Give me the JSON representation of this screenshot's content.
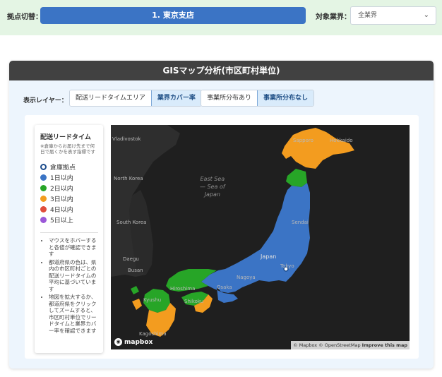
{
  "topbar": {
    "base_label": "拠点切替：",
    "base_value": "1. 東京支店",
    "industry_label": "対象業界：",
    "industry_value": "全業界",
    "chevron_icon": "chevron-down-icon"
  },
  "panel": {
    "title": "GISマップ分析(市区町村単位)",
    "layer_label": "表示レイヤー：",
    "layer_group1": [
      "配送リードタイムエリア",
      "業界カバー率"
    ],
    "layer_group2": [
      "事業所分布あり",
      "事業所分布なし"
    ],
    "active": [
      "業界カバー率",
      "事業所分布なし"
    ]
  },
  "legend": {
    "title": "配送リードタイム",
    "note": "※倉庫からお届け先まで何日で届くかを表す指標です",
    "items": [
      {
        "label": "倉庫拠点",
        "color": "#1c4c8c",
        "kind": "ring"
      },
      {
        "label": "1日以内",
        "color": "#3b74c5"
      },
      {
        "label": "2日以内",
        "color": "#27a527"
      },
      {
        "label": "3日以内",
        "color": "#f39c1f"
      },
      {
        "label": "4日以内",
        "color": "#e04e3c"
      },
      {
        "label": "5日以上",
        "color": "#9b58d8"
      }
    ],
    "tips": [
      "マウスをホバーすると各値が確認できます",
      "都道府県の色は、県内の市区町村ごとの配送リードタイムの平均に基づいています",
      "地図を拡大するか、都道府県をクリックしてズームすると、市区町村単位でリードタイムと業界カバー率を確認できます"
    ]
  },
  "map": {
    "sea_lines": [
      "East Sea",
      "— Sea of",
      "Japan"
    ],
    "labels": {
      "vladivostok": "Vladivostok",
      "north_korea": "North Korea",
      "south_korea": "South Korea",
      "daegu": "Daegu",
      "busan": "Busan",
      "sapporo": "Sapporo",
      "hokkaido": "Hokkaido",
      "sendai": "Sendai",
      "japan": "Japan",
      "nagoya": "Nagoya",
      "osaka": "Osaka",
      "tokyo": "Tokyo",
      "hiroshima": "Hiroshima",
      "kyushu": "Kyushu",
      "shikoku": "Shikoku",
      "kagoshima": "Kagoshima"
    },
    "attribution": "© Mapbox © OpenStreetMap",
    "improve": "Improve this map",
    "logo": "mapbox"
  },
  "colors": {
    "region1": "#3b74c5",
    "region2": "#27a527",
    "region3": "#f39c1f",
    "land": "#2e2e2e",
    "water": "#1f1f1f"
  }
}
